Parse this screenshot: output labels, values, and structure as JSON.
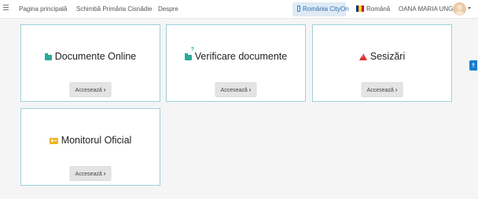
{
  "nav": {
    "home": "Pagina principală",
    "switch": "Schimbă Primăria Cisnădie",
    "about": "Despre",
    "cityon": "România CityOn",
    "language": "Română",
    "user": "OANA MARIA UNGUR"
  },
  "cards": [
    {
      "title": "Documente Online",
      "button": "Accesează",
      "icon": "folder-open-icon",
      "icon_color": "#2aa89a"
    },
    {
      "title": "Verificare documente",
      "button": "Accesează",
      "icon": "folder-question-icon",
      "icon_color": "#2aa89a"
    },
    {
      "title": "Sesizări",
      "button": "Accesează",
      "icon": "warning-icon",
      "icon_color": "#d9302c"
    },
    {
      "title": "Monitorul Oficial",
      "button": "Accesează",
      "icon": "id-card-icon",
      "icon_color": "#f0b429"
    }
  ],
  "accessibility": {
    "icon": "accessibility-icon",
    "color": "#1b7bd0"
  }
}
